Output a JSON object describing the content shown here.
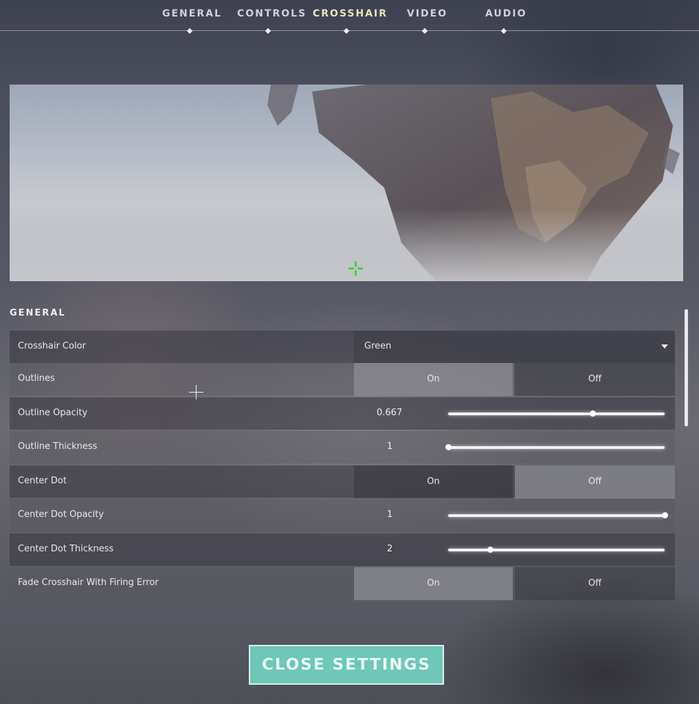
{
  "nav": {
    "tabs": [
      {
        "label": "GENERAL",
        "active": false
      },
      {
        "label": "CONTROLS",
        "active": false
      },
      {
        "label": "CROSSHAIR",
        "active": true
      },
      {
        "label": "VIDEO",
        "active": false
      },
      {
        "label": "AUDIO",
        "active": false
      }
    ]
  },
  "preview": {
    "crosshair_color": "#3fd23f"
  },
  "section": {
    "title": "GENERAL",
    "rows": [
      {
        "label": "Crosshair Color",
        "type": "dropdown",
        "value": "Green"
      },
      {
        "label": "Outlines",
        "type": "toggle",
        "on_label": "On",
        "off_label": "Off",
        "selected": "On"
      },
      {
        "label": "Outline Opacity",
        "type": "slider",
        "value": "0.667",
        "fraction": 0.667
      },
      {
        "label": "Outline Thickness",
        "type": "slider",
        "value": "1",
        "fraction": 0.0
      },
      {
        "label": "Center Dot",
        "type": "toggle",
        "on_label": "On",
        "off_label": "Off",
        "selected": "Off"
      },
      {
        "label": "Center Dot Opacity",
        "type": "slider",
        "value": "1",
        "fraction": 1.0
      },
      {
        "label": "Center Dot Thickness",
        "type": "slider",
        "value": "2",
        "fraction": 0.2
      },
      {
        "label": "Fade Crosshair With Firing Error",
        "type": "toggle",
        "on_label": "On",
        "off_label": "Off",
        "selected": "On"
      }
    ]
  },
  "footer": {
    "close_label": "CLOSE SETTINGS"
  },
  "colors": {
    "accent_teal": "#6ec7b8",
    "active_tab": "#e8e6b8"
  }
}
